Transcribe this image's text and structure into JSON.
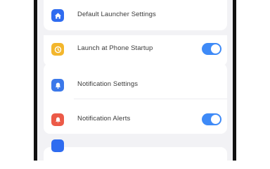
{
  "settings": {
    "rows": [
      {
        "label": "Default Launcher Settings",
        "icon": "home-icon",
        "icon_color": "#2f6cf0",
        "has_toggle": false
      },
      {
        "label": "Launch at Phone Startup",
        "icon": "clock-icon",
        "icon_color": "#f3b62c",
        "has_toggle": true,
        "toggle_on": true
      },
      {
        "label": "Notification Settings",
        "icon": "bell-icon",
        "icon_color": "#3b78ea",
        "has_toggle": false
      },
      {
        "label": "Notification Alerts",
        "icon": "alert-icon",
        "icon_color": "#ec5a48",
        "has_toggle": true,
        "toggle_on": true
      }
    ]
  },
  "colors": {
    "toggle_on": "#3e8af7",
    "background": "#f2f2f5",
    "card": "#ffffff"
  }
}
